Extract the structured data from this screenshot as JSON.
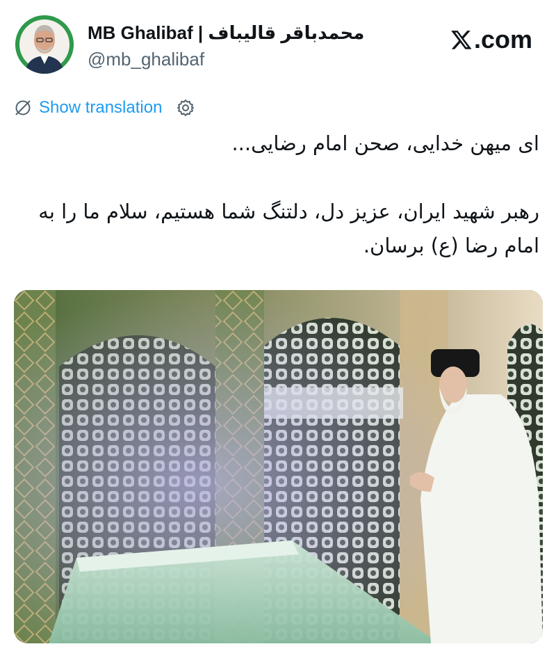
{
  "author": {
    "display_name": "MB Ghalibaf | محمدباقر قالیباف",
    "handle": "@mb_ghalibaf"
  },
  "brand": {
    "label": ".com",
    "icon": "x-logo-icon"
  },
  "translation": {
    "label": "Show translation",
    "icon": "globe-slash-icon",
    "settings_icon": "gear-icon"
  },
  "tweet": {
    "lines": [
      "ای میهن خدایی، صحن امام رضایی...",
      "رهبر شهید ایران، عزیز دل، دلتنگ شما هستیم، سلام ما را به امام رضا (ع) برسان."
    ]
  },
  "colors": {
    "link": "#1d9bf0",
    "text": "#0f1419",
    "secondary": "#536471"
  }
}
